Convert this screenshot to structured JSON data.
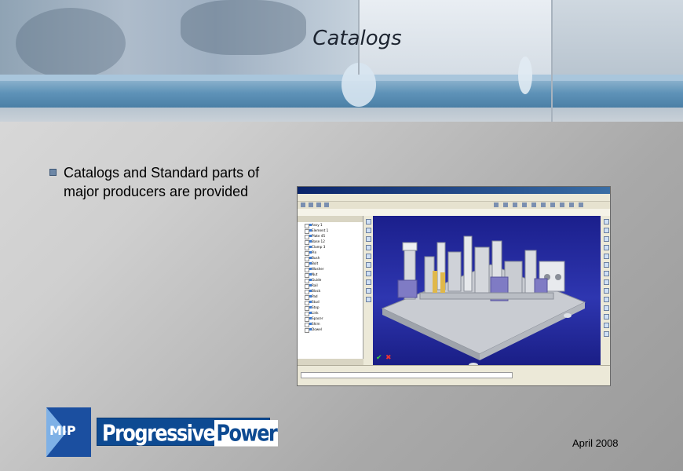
{
  "slide": {
    "title": "Catalogs",
    "bullet_text": "Catalogs and Standard parts of major producers are provided",
    "date": "April 2008"
  },
  "logos": {
    "mip_text": "MIP",
    "brand_part1": "Progressive",
    "brand_part2": "Power"
  },
  "colors": {
    "header_band": "#4a7fa6",
    "brand_blue": "#0d4a92",
    "viewport_blue": "#2e36b0"
  },
  "cad_window": {
    "tree_rows": [
      "Assy 1",
      "Element 1",
      "Plate 45",
      "Base 12",
      "Clamp 3",
      "Pin",
      "Bush",
      "Bolt",
      "Washer",
      "Nut",
      "Guide",
      "Rail",
      "Block",
      "Pad",
      "Stud",
      "Stop",
      "Link",
      "Spacer",
      "Shim",
      "Dowel"
    ]
  }
}
